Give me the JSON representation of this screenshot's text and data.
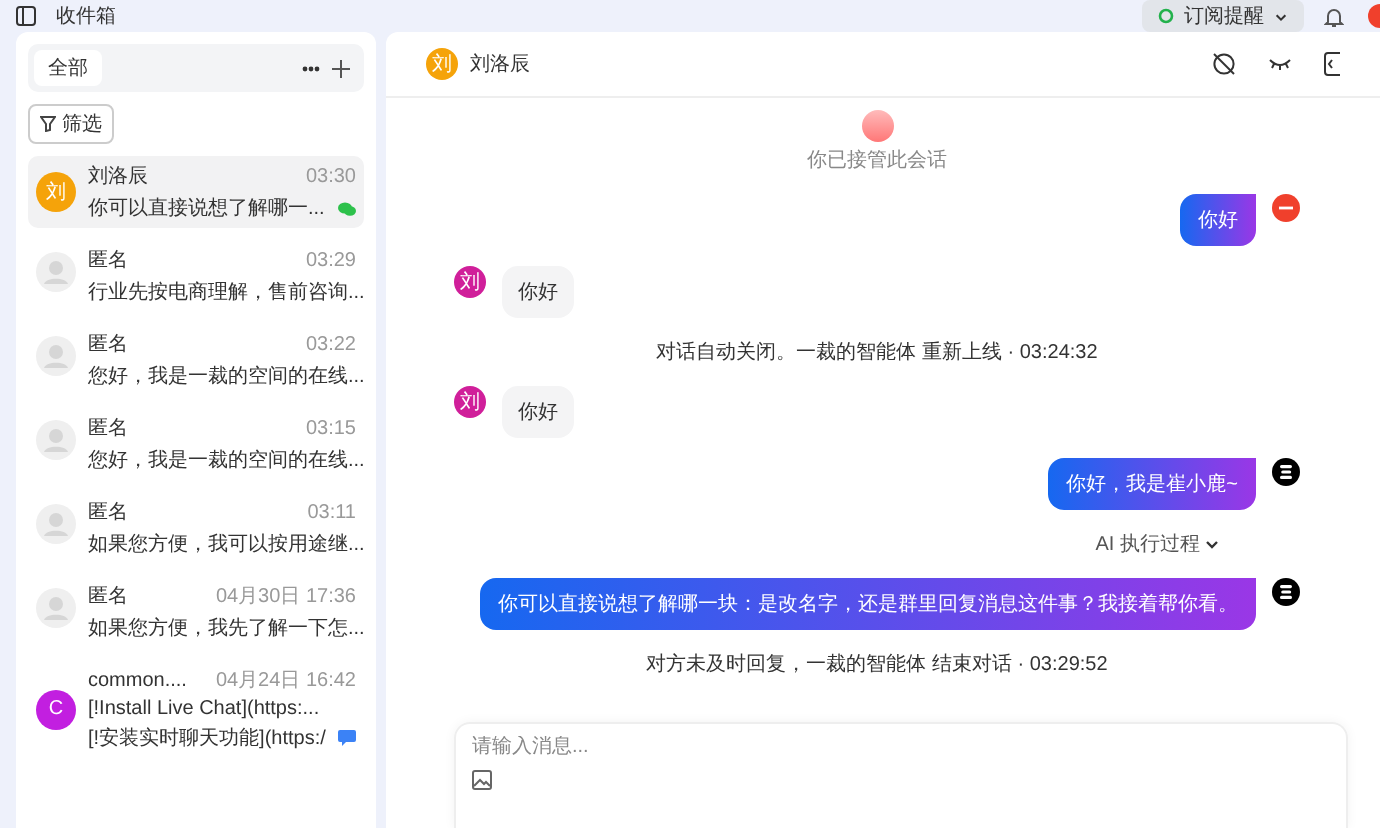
{
  "topbar": {
    "title": "收件箱",
    "subscribe": {
      "label": "订阅提醒",
      "on": true
    }
  },
  "sidebar": {
    "tabs": [
      {
        "label": "全部",
        "selected": true
      }
    ],
    "filter": "筛选",
    "conversations": [
      {
        "name": "刘洛辰",
        "time": "03:30",
        "preview": "你可以直接说想了解哪一...",
        "avatar": {
          "kind": "letter",
          "text": "刘",
          "color": "#f5a30a"
        },
        "channel": {
          "kind": "wechat"
        },
        "selected": true
      },
      {
        "name": "匿名",
        "time": "03:29",
        "preview": "行业先按电商理解，售前咨询...",
        "avatar": {
          "kind": "anonymous"
        },
        "selected": false
      },
      {
        "name": "匿名",
        "time": "03:22",
        "preview": "您好，我是一裁的空间的在线...",
        "avatar": {
          "kind": "anonymous"
        },
        "selected": false
      },
      {
        "name": "匿名",
        "time": "03:15",
        "preview": "您好，我是一裁的空间的在线...",
        "avatar": {
          "kind": "anonymous"
        },
        "selected": false
      },
      {
        "name": "匿名",
        "time": "03:11",
        "preview": "如果您方便，我可以按用途继...",
        "avatar": {
          "kind": "anonymous"
        },
        "selected": false
      },
      {
        "name": "匿名",
        "time": "04月30日 17:36",
        "preview": "如果您方便，我先了解一下怎...",
        "avatar": {
          "kind": "anonymous"
        },
        "selected": false
      },
      {
        "name": "common....",
        "time": "04月24日 16:42",
        "preview": "[!Install Live Chat](https:...",
        "preview_2": "[!安装实时聊天功能](https:/",
        "avatar": {
          "kind": "letter",
          "text": "C",
          "color": "#c21fe0"
        },
        "channel": {
          "kind": "livechat"
        },
        "selected": false
      }
    ]
  },
  "chat": {
    "header": {
      "name": "刘洛辰",
      "avatar": {
        "text": "刘",
        "color": "#f5a30a"
      }
    },
    "messages": [
      {
        "kind": "notice",
        "text": "你已接管此会话"
      },
      {
        "kind": "outgoing",
        "sender": {
          "kind": "agent"
        },
        "text": "你好"
      },
      {
        "kind": "incoming",
        "avatar": {
          "text": "刘",
          "color": "#d01f9a"
        },
        "text": "你好"
      },
      {
        "kind": "event",
        "text": "对话自动关闭。一裁的智能体 重新上线 · 03:24:32"
      },
      {
        "kind": "incoming",
        "avatar": {
          "text": "刘",
          "color": "#d01f9a"
        },
        "text": "你好"
      },
      {
        "kind": "outgoing",
        "sender": {
          "kind": "bot"
        },
        "text": "你好，我是崔小鹿~"
      },
      {
        "kind": "ai_toggle",
        "text": "AI 执行过程",
        "expanded": false
      },
      {
        "kind": "outgoing",
        "sender": {
          "kind": "bot"
        },
        "text": "你可以直接说想了解哪一块：是改名字，还是群里回复消息这件事？我接着帮你看。"
      },
      {
        "kind": "event",
        "text": "对方未及时回复，一裁的智能体 结束对话 · 03:29:52"
      }
    ],
    "composer": {
      "placeholder": "请输入消息..."
    }
  }
}
